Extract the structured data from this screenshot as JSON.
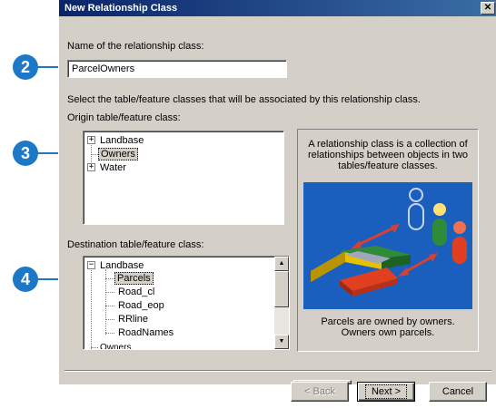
{
  "window": {
    "title": "New Relationship Class",
    "close_glyph": "✕"
  },
  "name_section": {
    "label": "Name of the relationship class:",
    "value": "ParcelOwners"
  },
  "instruction": "Select the table/feature classes that will be associated by this relationship class.",
  "origin": {
    "label": "Origin table/feature class:",
    "items": [
      {
        "label": "Landbase",
        "expander": "+"
      },
      {
        "label": "Owners",
        "selected": true
      },
      {
        "label": "Water",
        "expander": "+"
      }
    ]
  },
  "destination": {
    "label": "Destination table/feature class:",
    "root": {
      "label": "Landbase",
      "expander": "−"
    },
    "children": [
      "Parcels",
      "Road_cl",
      "Road_eop",
      "RRline",
      "RoadNames"
    ],
    "partial": "Owners"
  },
  "info": {
    "description": "A relationship class is a collection of relationships between objects in two tables/feature classes.",
    "caption_line1": "Parcels are owned by owners.",
    "caption_line2": "Owners own parcels.",
    "illustration_color": "#1a5fbe"
  },
  "buttons": {
    "back": "< Back",
    "next": "Next >",
    "cancel": "Cancel"
  },
  "callouts": {
    "c2": "2",
    "c3": "3",
    "c4": "4",
    "color": "#1e78c8"
  },
  "scrollbar": {
    "up_glyph": "▲",
    "down_glyph": "▼"
  }
}
